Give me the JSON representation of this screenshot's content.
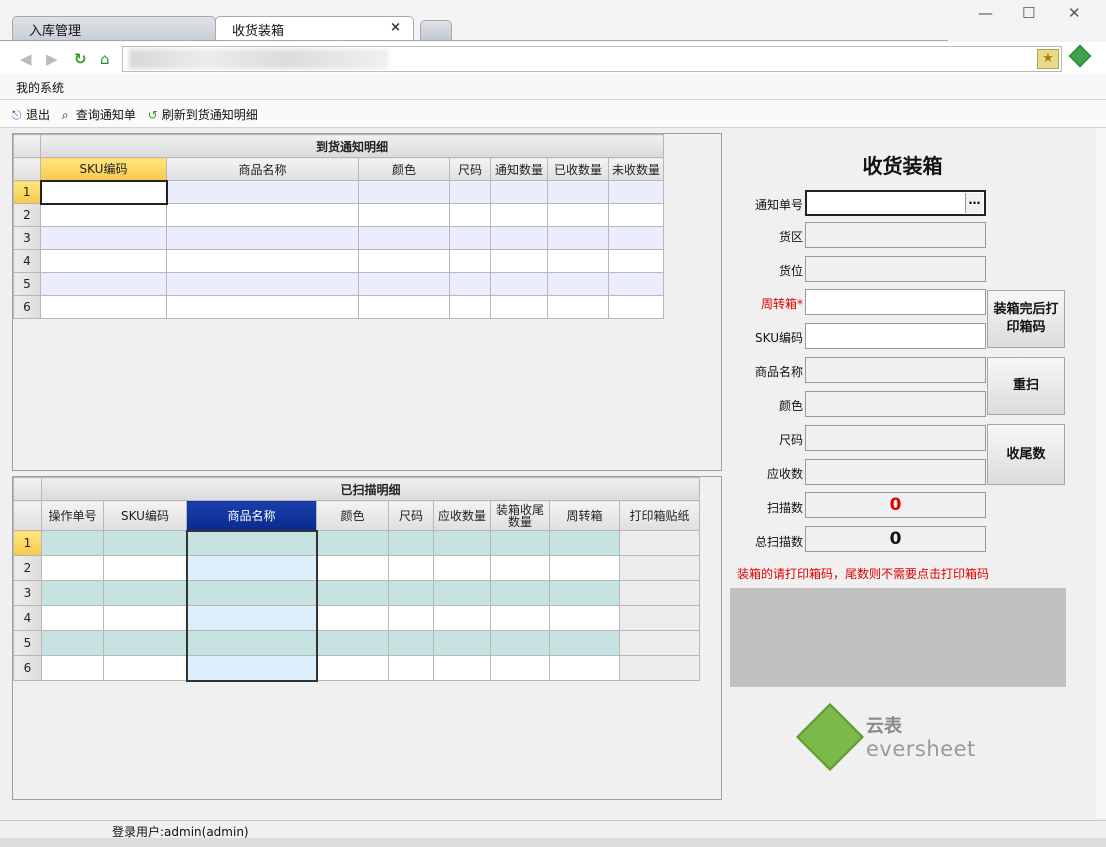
{
  "browser": {
    "tabs": [
      {
        "label": "入库管理",
        "active": false
      },
      {
        "label": "收货装箱",
        "active": true
      }
    ]
  },
  "menu": {
    "system": "我的系统"
  },
  "toolbar": {
    "exit": "退出",
    "query": "查询通知单",
    "refresh": "刷新到货通知明细"
  },
  "arrival_grid": {
    "title": "到货通知明细",
    "columns": [
      "SKU编码",
      "商品名称",
      "颜色",
      "尺码",
      "通知数量",
      "已收数量",
      "未收数量"
    ],
    "rows": [
      "1",
      "2",
      "3",
      "4",
      "5",
      "6"
    ]
  },
  "scanned_grid": {
    "title": "已扫描明细",
    "columns": [
      "操作单号",
      "SKU编码",
      "商品名称",
      "颜色",
      "尺码",
      "应收数量",
      "装箱收尾数量",
      "周转箱",
      "打印箱贴纸"
    ],
    "rows": [
      "1",
      "2",
      "3",
      "4",
      "5",
      "6"
    ]
  },
  "panel": {
    "title": "收货装箱",
    "fields": {
      "notice_no": "通知单号",
      "zone": "货区",
      "location": "货位",
      "box": "周转箱*",
      "sku": "SKU编码",
      "product_name": "商品名称",
      "color": "颜色",
      "size": "尺码",
      "receivable": "应收数",
      "scanned": "扫描数",
      "total_scanned": "总扫描数"
    },
    "scanned_value": "0",
    "total_scanned_value": "0",
    "buttons": {
      "print_box": "装箱完后打印箱码",
      "rescan": "重扫",
      "finish": "收尾数"
    },
    "note": "装箱的请打印箱码，尾数则不需要点击打印箱码"
  },
  "logo": {
    "cn": "云表",
    "en": "eversheet"
  },
  "status": {
    "user": "登录用户:admin(admin)"
  },
  "colors": {
    "accent_red": "#e00000",
    "header_blue": "#0a2a8c",
    "selected_yellow": "#f8c94a"
  }
}
